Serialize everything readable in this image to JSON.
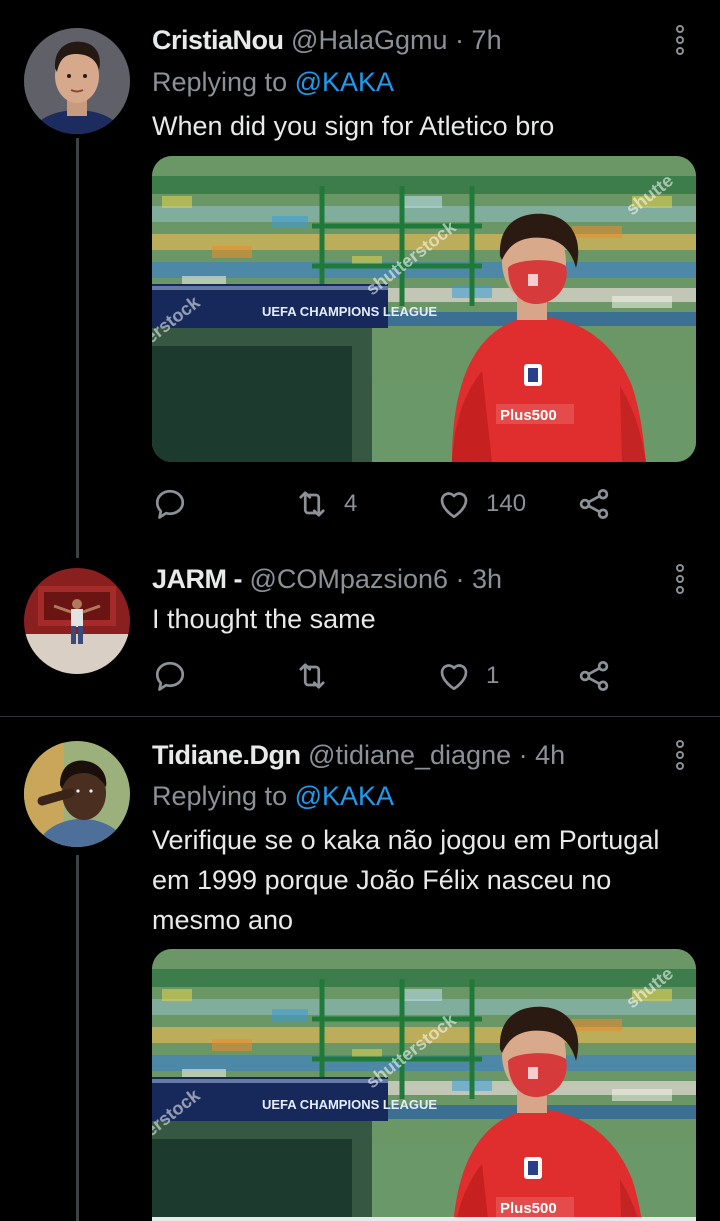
{
  "tweets": [
    {
      "name": "CristiaNou",
      "handle": "@HalaGgmu",
      "time": "7h",
      "replying_prefix": "Replying to",
      "replying_to": "@KAKA",
      "text": "When did you sign for Atletico bro",
      "has_media": true,
      "replies": "",
      "retweets": "4",
      "likes": "140"
    },
    {
      "name": "JARM -",
      "handle": "@COMpazsion6",
      "time": "3h",
      "text": "I thought the same",
      "replies": "",
      "retweets": "",
      "likes": "1"
    },
    {
      "name": "Tidiane.Dgn",
      "handle": "@tidiane_diagne",
      "time": "4h",
      "replying_prefix": "Replying to",
      "replying_to": "@KAKA",
      "text": "Verifique se o kaka não jogou em Portugal em 1999 porque João Félix nasceu no mesmo ano",
      "has_media": true
    }
  ],
  "separator": "·",
  "media": {
    "banner_text": "UEFA CHAMPIONS LEAGUE",
    "watermark": "shutterstock",
    "watermark_right": "shutte",
    "watermark_left": "terstock",
    "sponsor": "Plus500"
  },
  "icons": {
    "reply": "reply-icon",
    "retweet": "retweet-icon",
    "like": "heart-icon",
    "share": "share-icon",
    "more": "more-vertical-icon"
  },
  "colors": {
    "background": "#000000",
    "link": "#1d9bf0",
    "secondary_text": "#8b9196",
    "primary_text": "#e7e9ea"
  }
}
